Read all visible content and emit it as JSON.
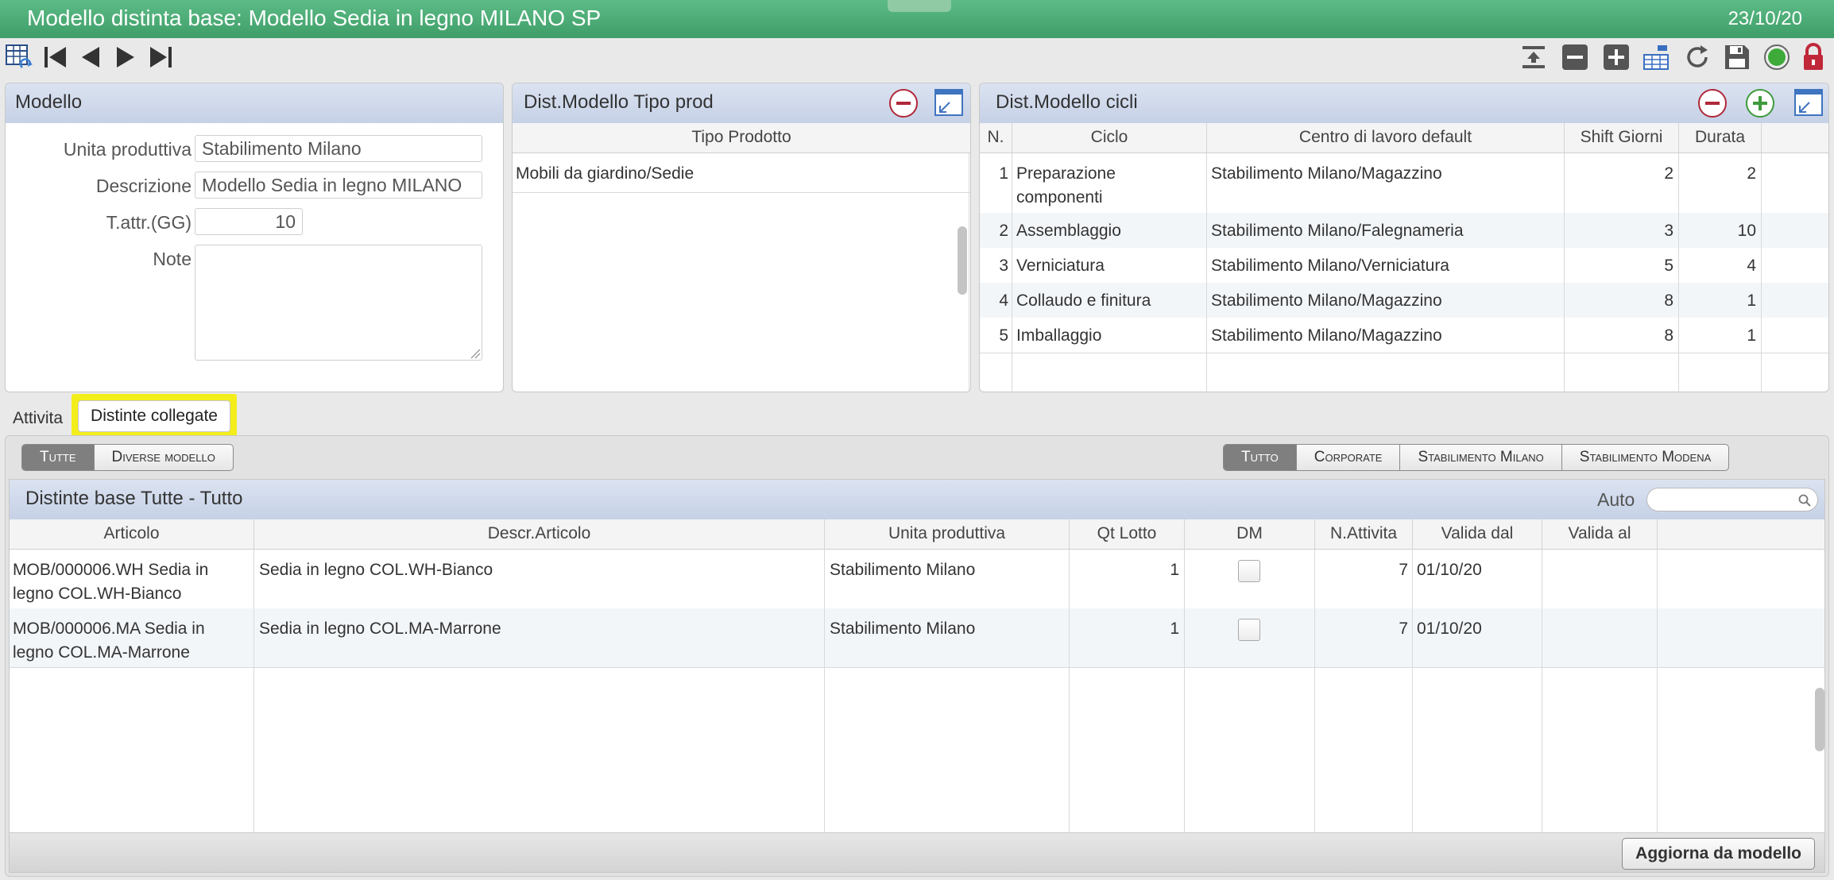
{
  "window": {
    "title": "Modello distinta base: Modello Sedia in legno MILANO SP",
    "date": "23/10/20"
  },
  "toolbar": {
    "left_icons": [
      "table-refresh-icon",
      "first-record-icon",
      "previous-record-icon",
      "next-record-icon",
      "last-record-icon"
    ],
    "right_icons": [
      "insert-row-icon",
      "remove-icon",
      "add-icon",
      "hierarchy-icon",
      "refresh-icon",
      "save-icon",
      "status-icon",
      "lock-icon"
    ]
  },
  "modello": {
    "header": "Modello",
    "unita_label": "Unita produttiva",
    "unita_value": "Stabilimento Milano",
    "descr_label": "Descrizione",
    "descr_value": "Modello Sedia in legno MILANO",
    "tattr_label": "T.attr.(GG)",
    "tattr_value": "10",
    "note_label": "Note",
    "note_value": ""
  },
  "tipo_prod": {
    "header": "Dist.Modello Tipo prod",
    "column": "Tipo Prodotto",
    "rows": [
      "Mobili da giardino/Sedie"
    ]
  },
  "cicli": {
    "header": "Dist.Modello cicli",
    "columns": [
      "N.",
      "Ciclo",
      "Centro di lavoro default",
      "Shift Giorni",
      "Durata"
    ],
    "rows": [
      {
        "n": "1",
        "ciclo_1": "Preparazione",
        "ciclo_2": "componenti",
        "centro": "Stabilimento Milano/Magazzino",
        "shift": "2",
        "durata": "2"
      },
      {
        "n": "2",
        "ciclo_1": "Assemblaggio",
        "ciclo_2": "",
        "centro": "Stabilimento Milano/Falegnameria",
        "shift": "3",
        "durata": "10"
      },
      {
        "n": "3",
        "ciclo_1": "Verniciatura",
        "ciclo_2": "",
        "centro": "Stabilimento Milano/Verniciatura",
        "shift": "5",
        "durata": "4"
      },
      {
        "n": "4",
        "ciclo_1": "Collaudo e finitura",
        "ciclo_2": "",
        "centro": "Stabilimento Milano/Magazzino",
        "shift": "8",
        "durata": "1"
      },
      {
        "n": "5",
        "ciclo_1": "Imballaggio",
        "ciclo_2": "",
        "centro": "Stabilimento Milano/Magazzino",
        "shift": "8",
        "durata": "1"
      }
    ]
  },
  "tabs": {
    "attivita": "Attivita",
    "distinte": "Distinte collegate"
  },
  "filters": {
    "left": [
      "Tutte",
      "Diverse modello"
    ],
    "right": [
      "Tutto",
      "Corporate",
      "Stabilimento Milano",
      "Stabilimento Modena"
    ]
  },
  "distinte": {
    "header": "Distinte base Tutte - Tutto",
    "auto_label": "Auto",
    "search_placeholder": "",
    "columns": [
      "Articolo",
      "Descr.Articolo",
      "Unita produttiva",
      "Qt Lotto",
      "DM",
      "N.Attivita",
      "Valida dal",
      "Valida al"
    ],
    "rows": [
      {
        "art_1": "MOB/000006.WH Sedia in",
        "art_2": "legno COL.WH-Bianco",
        "descr": "Sedia in legno COL.WH-Bianco",
        "unita": "Stabilimento Milano",
        "qt": "1",
        "dm": false,
        "natt": "7",
        "dal": "01/10/20",
        "al": ""
      },
      {
        "art_1": "MOB/000006.MA Sedia in",
        "art_2": "legno COL.MA-Marrone",
        "descr": "Sedia in legno COL.MA-Marrone",
        "unita": "Stabilimento Milano",
        "qt": "1",
        "dm": false,
        "natt": "7",
        "dal": "01/10/20",
        "al": ""
      }
    ],
    "update_button": "Aggiorna da modello"
  },
  "colors": {
    "title_bar": "#4aa874",
    "panel_header": "#ccd6ea",
    "highlight": "#f3ee1a",
    "remove_red": "#b0283a",
    "add_green": "#3e9a3c"
  }
}
